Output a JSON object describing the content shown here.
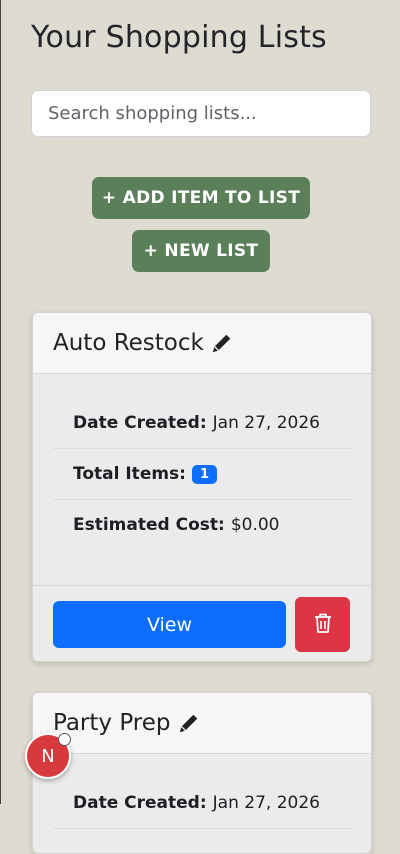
{
  "page": {
    "title": "Your Shopping Lists",
    "search_placeholder": "Search shopping lists..."
  },
  "actions": {
    "add_item_label": "+ ADD ITEM TO LIST",
    "new_list_label": "+ NEW LIST"
  },
  "labels": {
    "date_created": "Date Created:",
    "total_items": "Total Items:",
    "estimated_cost": "Estimated Cost:",
    "view": "View"
  },
  "lists": [
    {
      "name": "Auto Restock",
      "date_created": "Jan 27, 2026",
      "total_items": "1",
      "estimated_cost": "$0.00"
    },
    {
      "name": "Party Prep",
      "date_created": "Jan 27, 2026"
    }
  ],
  "fab": {
    "letter": "N"
  },
  "colors": {
    "background": "#dedbd0",
    "green_button": "#5a7f59",
    "primary": "#0d6efd",
    "danger": "#dc3545"
  },
  "icons": [
    "pencil-icon",
    "trash-icon"
  ]
}
